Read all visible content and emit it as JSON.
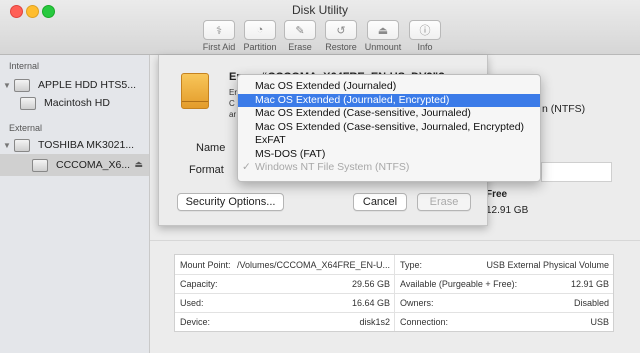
{
  "window": {
    "title": "Disk Utility"
  },
  "toolbar": [
    {
      "label": "First Aid",
      "icon": "stethoscope-icon",
      "glyph": "⚕"
    },
    {
      "label": "Partition",
      "icon": "partition-icon",
      "glyph": "◔"
    },
    {
      "label": "Erase",
      "icon": "erase-icon",
      "glyph": "✎"
    },
    {
      "label": "Restore",
      "icon": "restore-icon",
      "glyph": "↺"
    },
    {
      "label": "Unmount",
      "icon": "unmount-icon",
      "glyph": "⏏"
    },
    {
      "label": "Info",
      "icon": "info-icon",
      "glyph": "ⓘ"
    }
  ],
  "sidebar": {
    "internal_label": "Internal",
    "external_label": "External",
    "internal_items": [
      {
        "label": "APPLE HDD HTS5...",
        "level": 0
      },
      {
        "label": "Macintosh HD",
        "level": 1
      }
    ],
    "external_items": [
      {
        "label": "TOSHIBA MK3021...",
        "level": 0
      },
      {
        "label": "CCCOMA_X6...",
        "level": 1,
        "selected": true
      }
    ]
  },
  "sheet": {
    "heading": "Erase “CCCOMA_X64FRE_EN-US_DV9”?",
    "body_fragments": [
      "Er",
      "C",
      "ar"
    ],
    "name_label": "Name",
    "format_label": "Format",
    "security_button": "Security Options...",
    "cancel_button": "Cancel",
    "erase_button": "Erase"
  },
  "format_menu": {
    "items": [
      {
        "label": "Mac OS Extended (Journaled)",
        "state": "normal"
      },
      {
        "label": "Mac OS Extended (Journaled, Encrypted)",
        "state": "highlighted"
      },
      {
        "label": "Mac OS Extended (Case-sensitive, Journaled)",
        "state": "normal"
      },
      {
        "label": "Mac OS Extended (Case-sensitive, Journaled, Encrypted)",
        "state": "normal"
      },
      {
        "label": "ExFAT",
        "state": "normal"
      },
      {
        "label": "MS-DOS (FAT)",
        "state": "normal"
      },
      {
        "label": "Windows NT File System (NTFS)",
        "state": "disabled",
        "checked": true
      }
    ],
    "check_glyph": "✓"
  },
  "background": {
    "fs_fragment": "n (NTFS)",
    "free_label": "Free",
    "free_value": "12.91 GB"
  },
  "info_table": {
    "left": [
      {
        "key": "Mount Point:",
        "value": "/Volumes/CCCOMA_X64FRE_EN-U..."
      },
      {
        "key": "Capacity:",
        "value": "29.56 GB"
      },
      {
        "key": "Used:",
        "value": "16.64 GB"
      },
      {
        "key": "Device:",
        "value": "disk1s2"
      }
    ],
    "right": [
      {
        "key": "Type:",
        "value": "USB External Physical Volume"
      },
      {
        "key": "Available (Purgeable + Free):",
        "value": "12.91 GB"
      },
      {
        "key": "Owners:",
        "value": "Disabled"
      },
      {
        "key": "Connection:",
        "value": "USB"
      }
    ]
  },
  "colors": {
    "highlight": "#3b7be8",
    "disk_icon": "#f0ad3c"
  }
}
